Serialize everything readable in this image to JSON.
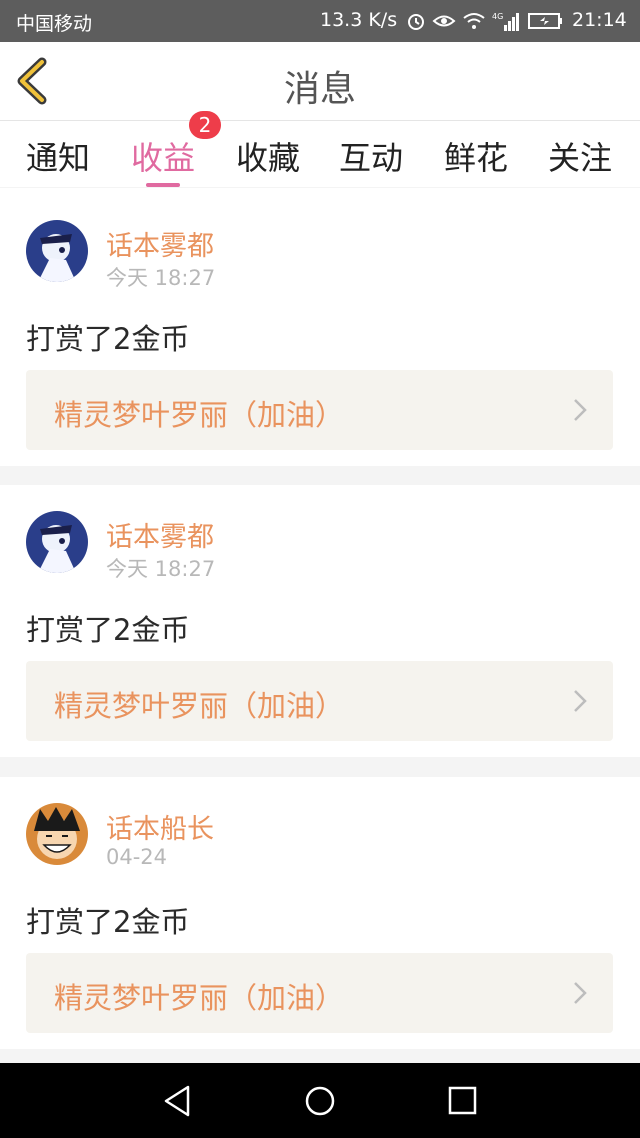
{
  "status_bar": {
    "carrier": "中国移动",
    "speed": "13.3 K/s",
    "time": "21:14",
    "icons": [
      "alarm-icon",
      "eye-icon",
      "wifi-icon",
      "signal-4g-icon",
      "battery-icon"
    ]
  },
  "header": {
    "title": "消息",
    "back_icon": "chevron-left-icon"
  },
  "tabs": [
    {
      "label": "通知"
    },
    {
      "label": "收益",
      "badge": "2",
      "active": true
    },
    {
      "label": "收藏"
    },
    {
      "label": "互动"
    },
    {
      "label": "鲜花"
    },
    {
      "label": "关注"
    }
  ],
  "messages": [
    {
      "user": "话本雾都",
      "time": "今天 18:27",
      "text": "打赏了2金币",
      "book": "精灵梦叶罗丽（加油）"
    },
    {
      "user": "话本雾都",
      "time": "今天 18:27",
      "text": "打赏了2金币",
      "book": "精灵梦叶罗丽（加油）"
    },
    {
      "user": "话本船长",
      "time": "04-24",
      "text": "打赏了2金币",
      "book": "精灵梦叶罗丽（加油）"
    }
  ],
  "colors": {
    "accent_pink": "#e06aa0",
    "username_orange": "#e9935e",
    "badge_red": "#ee3d4a",
    "book_bg": "#f5f3ee"
  },
  "nav_bar": [
    "back-triangle-icon",
    "home-circle-icon",
    "recents-square-icon"
  ]
}
